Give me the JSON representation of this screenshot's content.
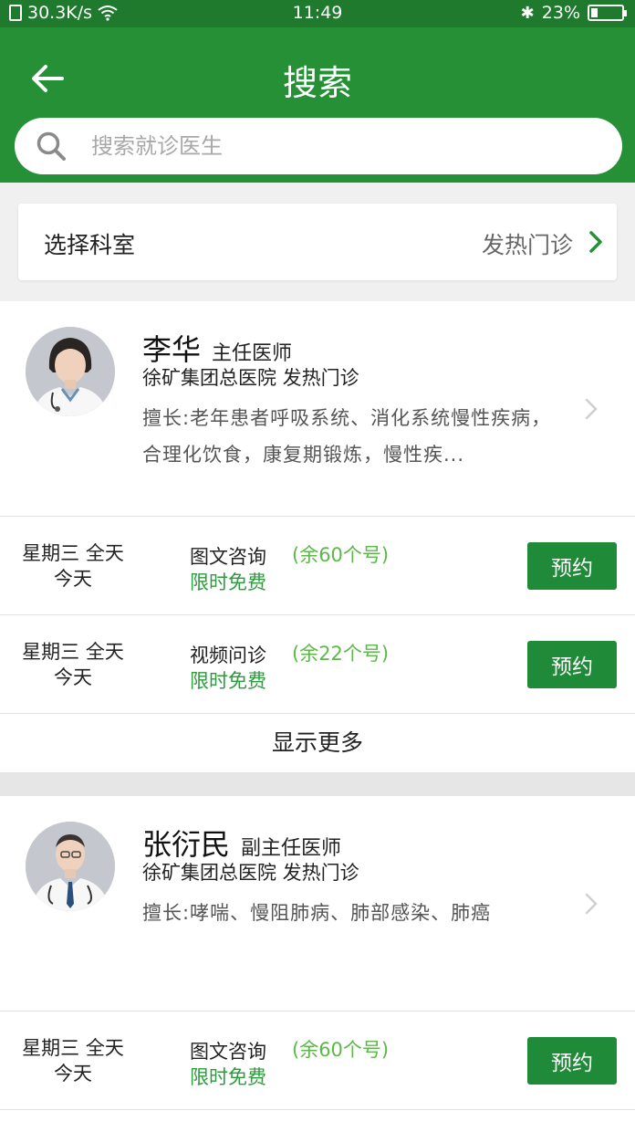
{
  "status_bar": {
    "speed": "30.3K/s",
    "time": "11:49",
    "battery": "23%",
    "battery_level": 0.23
  },
  "header": {
    "title": "搜索"
  },
  "search": {
    "placeholder": "搜索就诊医生"
  },
  "department": {
    "label": "选择科室",
    "value": "发热门诊"
  },
  "doctors": [
    {
      "name": "李华",
      "title": "主任医师",
      "hospital": "徐矿集团总医院 发热门诊",
      "specialty": "擅长:老年患者呼吸系统、消化系统慢性疾病，合理化饮食，康复期锻炼，慢性疾...",
      "slots": [
        {
          "day": "星期三 全天",
          "date": "今天",
          "type": "图文咨询",
          "remaining": "(余60个号)",
          "price": "限时免费",
          "button": "预约"
        },
        {
          "day": "星期三 全天",
          "date": "今天",
          "type": "视频问诊",
          "remaining": "(余22个号)",
          "price": "限时免费",
          "button": "预约"
        }
      ],
      "show_more": "显示更多"
    },
    {
      "name": "张衍民",
      "title": "副主任医师",
      "hospital": "徐矿集团总医院 发热门诊",
      "specialty": "擅长:哮喘、慢阻肺病、肺部感染、肺癌",
      "slots": [
        {
          "day": "星期三 全天",
          "date": "今天",
          "type": "图文咨询",
          "remaining": "(余60个号)",
          "price": "限时免费",
          "button": "预约"
        }
      ]
    }
  ],
  "colors": {
    "header_green": "#259035",
    "button_green": "#1f8a37",
    "remaining_green": "#5cb848"
  }
}
